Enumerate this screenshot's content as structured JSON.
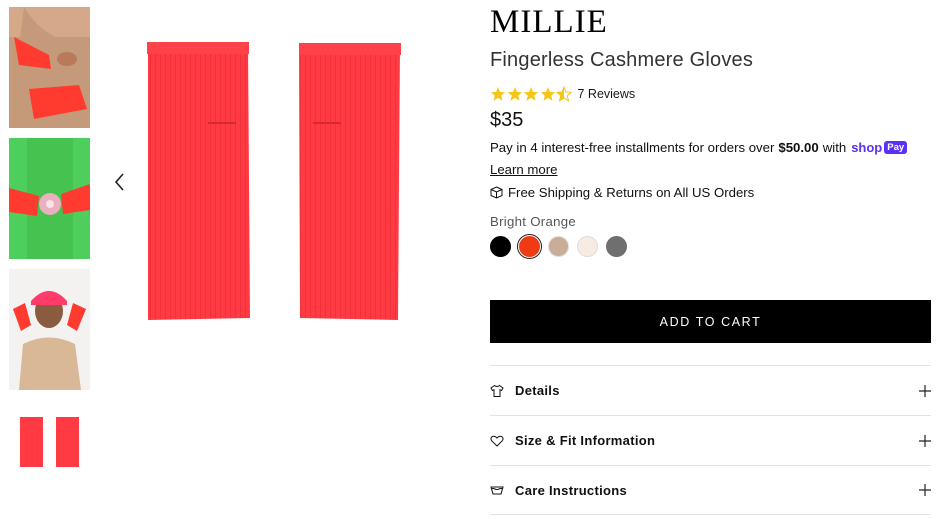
{
  "brand": "MILLIE",
  "product": {
    "title": "Fingerless Cashmere Gloves",
    "rating_value": 4.5,
    "reviews_label": "7 Reviews",
    "price": "$35"
  },
  "installments": {
    "prefix": "Pay in 4 interest-free installments for orders over",
    "threshold": "$50.00",
    "suffix": "with",
    "shop_word": "shop",
    "pay_badge": "Pay",
    "learn_more": "Learn more"
  },
  "shipping_text": "Free Shipping & Returns on All US Orders",
  "color": {
    "selected_name": "Bright Orange",
    "swatches": [
      {
        "name": "black",
        "hex": "#000000"
      },
      {
        "name": "bright-orange",
        "hex": "#f03a14"
      },
      {
        "name": "tan",
        "hex": "#c9ad98"
      },
      {
        "name": "cream",
        "hex": "#f7ece4"
      },
      {
        "name": "grey",
        "hex": "#6f6f6f"
      }
    ]
  },
  "cta": {
    "add_to_cart": "ADD TO CART"
  },
  "accordion": [
    {
      "label": "Details",
      "icon": "shirt-icon"
    },
    {
      "label": "Size & Fit Information",
      "icon": "heart-icon"
    },
    {
      "label": "Care Instructions",
      "icon": "basin-icon"
    }
  ],
  "colors": {
    "glove": "#ff3a43",
    "star": "#f5c518",
    "shop_purple": "#5a31f4"
  }
}
